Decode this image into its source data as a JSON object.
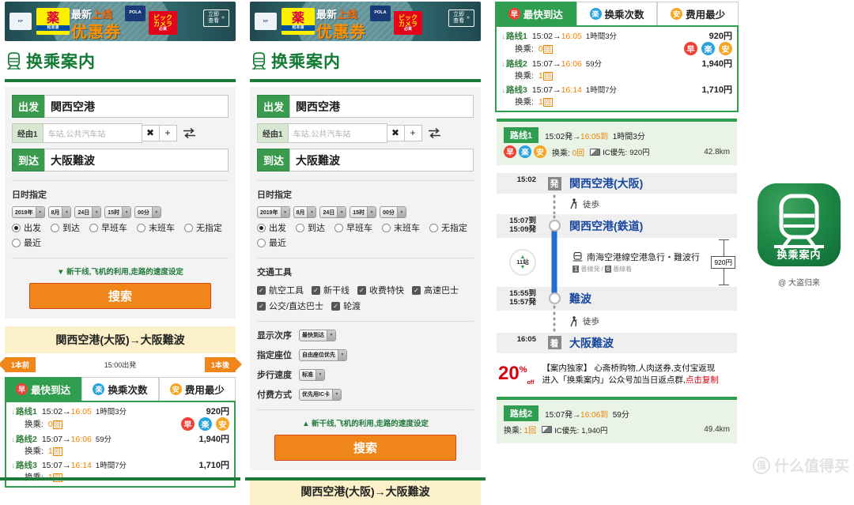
{
  "ad": {
    "brand_kf": "KF",
    "brand_matsu_main": "薬",
    "brand_matsu_sub": "松本清",
    "brand_pola": "POLA",
    "brand_bic_1": "ビック",
    "brand_bic_2": "カメラ",
    "brand_bic_3": "必買",
    "headline_plain": "最新",
    "headline_hl": "上线",
    "coupon": "优惠券",
    "cta_l1": "立即",
    "cta_l2": "查看",
    "cta_arrow": "»"
  },
  "app": {
    "title": "换乘案内",
    "icon": "train-icon",
    "icon_label": "换乘案内",
    "icon_caption": "@ 大盗归来"
  },
  "form": {
    "from_label": "出发",
    "from_value": "関西空港",
    "via_label": "经由1",
    "via_placeholder": "车站,公共汽车站",
    "via_clear": "✖",
    "via_add": "+",
    "swap_icon": "swap-icon",
    "to_label": "到达",
    "to_value": "大阪難波",
    "datetime_label": "日时指定",
    "selects": [
      {
        "name": "year",
        "value": "2019年"
      },
      {
        "name": "month",
        "value": "8月"
      },
      {
        "name": "day",
        "value": "24日"
      },
      {
        "name": "hour",
        "value": "15时"
      },
      {
        "name": "minute",
        "value": "00分"
      }
    ],
    "radios": [
      {
        "label": "出发",
        "selected": true
      },
      {
        "label": "到达",
        "selected": false
      },
      {
        "label": "早班车",
        "selected": false
      },
      {
        "label": "末班车",
        "selected": false
      },
      {
        "label": "无指定",
        "selected": false
      },
      {
        "label": "最近",
        "selected": false
      }
    ],
    "transport_label": "交通工具",
    "transport": [
      {
        "label": "航空工具",
        "checked": true
      },
      {
        "label": "新干线",
        "checked": true
      },
      {
        "label": "收费特快",
        "checked": true
      },
      {
        "label": "高速巴士",
        "checked": true
      },
      {
        "label": "公交/直达巴士",
        "checked": true
      },
      {
        "label": "轮渡",
        "checked": true
      }
    ],
    "options": [
      {
        "label": "显示次序",
        "value": "最快到达"
      },
      {
        "label": "指定座位",
        "value": "自由座位优先"
      },
      {
        "label": "步行速度",
        "value": "标准"
      },
      {
        "label": "付费方式",
        "value": "优先用IC卡"
      }
    ],
    "advanced_collapsed": "▼ 新干线,飞机的利用,走路的速度设定",
    "advanced_expanded": "▲ 新干线,飞机的利用,走路的速度设定",
    "search_button": "搜索"
  },
  "results": {
    "od_header": "関西空港(大阪)→大阪難波",
    "prev_label": "1本前",
    "depart_note": "15:00出発",
    "next_label": "1本後",
    "tabs": [
      {
        "label": "最快到达",
        "badge": "早",
        "badge_color": "#ef4136",
        "active": true
      },
      {
        "label": "换乘次数",
        "badge": "楽",
        "badge_color": "#29a3dc",
        "active": false
      },
      {
        "label": "费用最少",
        "badge": "安",
        "badge_color": "#f5a623",
        "active": false
      }
    ],
    "rows": [
      {
        "arrow": "↓",
        "route": "路线1",
        "dep": "15:02",
        "sep": "→",
        "arr": "16:05",
        "duration": "1時間3分",
        "fare": "920円",
        "transfer_label": "换乘:",
        "transfer_count": "0",
        "transfer_unit": "回",
        "badges": [
          "早",
          "楽",
          "安"
        ]
      },
      {
        "arrow": "↓",
        "route": "路线2",
        "dep": "15:07",
        "sep": "→",
        "arr": "16:06",
        "duration": "59分",
        "fare": "1,940円",
        "transfer_label": "换乘:",
        "transfer_count": "1",
        "transfer_unit": "回",
        "badges": []
      },
      {
        "arrow": "↓",
        "route": "路线3",
        "dep": "15:07",
        "sep": "→",
        "arr": "16:14",
        "duration": "1時間7分",
        "fare": "1,710円",
        "transfer_label": "换乘:",
        "transfer_count": "1",
        "transfer_unit": "回",
        "badges": []
      }
    ]
  },
  "detail": {
    "route1": {
      "chip": "路线1",
      "times": "15:02発→16:05到  1時間3分",
      "dep_time": "15:02発",
      "sep": "→",
      "arr_time": "16:05到",
      "duration": "1時間3分",
      "badges": [
        "早",
        "楽",
        "安"
      ],
      "transfer_label": "换乘:",
      "transfer_count": "0",
      "transfer_unit": "回",
      "ic_label": "IC優先:",
      "ic_fare": "920円",
      "distance": "42.8km"
    },
    "timeline": [
      {
        "type": "stop",
        "time": "15:02",
        "marker": "発",
        "station": "関西空港(大阪)"
      },
      {
        "type": "walk",
        "label": "徒歩",
        "icon": "walk-icon"
      },
      {
        "type": "stop",
        "time_arr": "15:07到",
        "time_dep": "15:09発",
        "marker": "circle",
        "station": "関西空港(鉄道)"
      },
      {
        "type": "train",
        "stops": "11站",
        "line": "南海空港線空港急行・難波行",
        "platform_dep_no": "1",
        "platform_dep": "番線発",
        "platform_sep": "/",
        "platform_arr_no": "6",
        "platform_arr": "番線着",
        "fare": "920円",
        "icon": "train-icon"
      },
      {
        "type": "stop",
        "time_arr": "15:55到",
        "time_dep": "15:57発",
        "marker": "circle",
        "station": "難波"
      },
      {
        "type": "walk",
        "label": "徒歩",
        "icon": "walk-icon"
      },
      {
        "type": "stop",
        "time": "16:05",
        "marker": "着",
        "station": "大阪難波"
      }
    ],
    "promo": {
      "percent": "20",
      "percent_sup": "%",
      "percent_sub": "off",
      "line1": "【案内独家】 心斋桥购物,人肉送券,支付宝返现",
      "line2_plain": "进入「换乘案内」公众号加当日返点群,",
      "line2_red": "点击复制"
    },
    "route2": {
      "chip": "路线2",
      "dep_time": "15:07発",
      "sep": "→",
      "arr_time": "16:06到",
      "duration": "59分",
      "transfer_label": "换乘:",
      "transfer_count": "1",
      "transfer_unit": "回",
      "ic_label": "IC優先:",
      "ic_fare": "1,940円",
      "distance": "49.4km"
    }
  },
  "watermark": {
    "mark": "值",
    "text": "什么值得买"
  }
}
